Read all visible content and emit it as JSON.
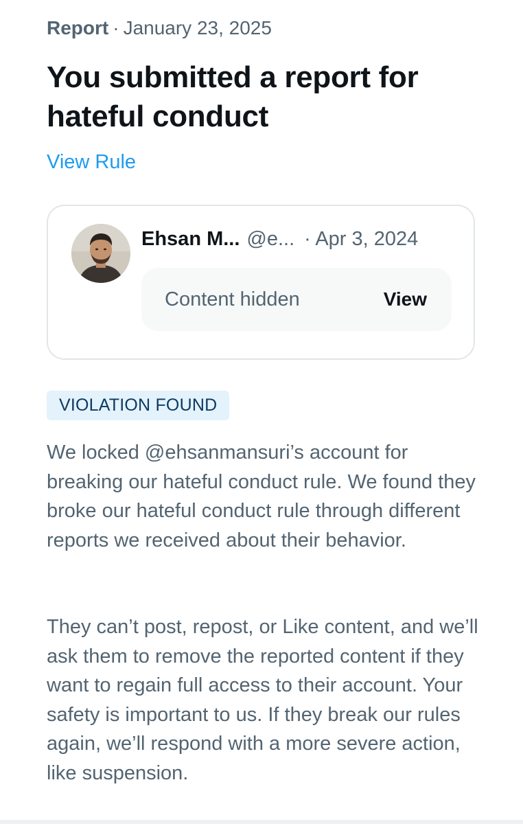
{
  "report": {
    "type_label": "Report",
    "separator": "·",
    "date": "January 23, 2025",
    "headline": "You submitted a report for hateful conduct",
    "view_rule_label": "View Rule"
  },
  "post": {
    "author_name": "Ehsan M...",
    "author_handle": "@e...",
    "separator": "·",
    "date": "Apr 3, 2024",
    "hidden_label": "Content hidden",
    "view_label": "View"
  },
  "outcome": {
    "badge": "VIOLATION FOUND",
    "paragraph_1": "We locked @ehsanmansuri’s account for breaking our hateful conduct rule. We found they broke our hateful conduct rule through different reports we received about their behavior.",
    "paragraph_2": "They can’t post, repost, or Like content, and we’ll ask them to remove the reported content if they want to regain full access to their account. Your safety is important to us. If they break our rules again, we’ll respond with a more severe action, like suspension."
  },
  "colors": {
    "link": "#1d9bf0",
    "secondary_text": "#536471",
    "primary_text": "#0f1419",
    "badge_background": "#e3f2fb",
    "badge_text": "#0e3a60",
    "card_border": "#e1e6ea",
    "hidden_box_background": "#f7f9f9"
  },
  "icons": {
    "avatar": "user-profile-photo"
  }
}
